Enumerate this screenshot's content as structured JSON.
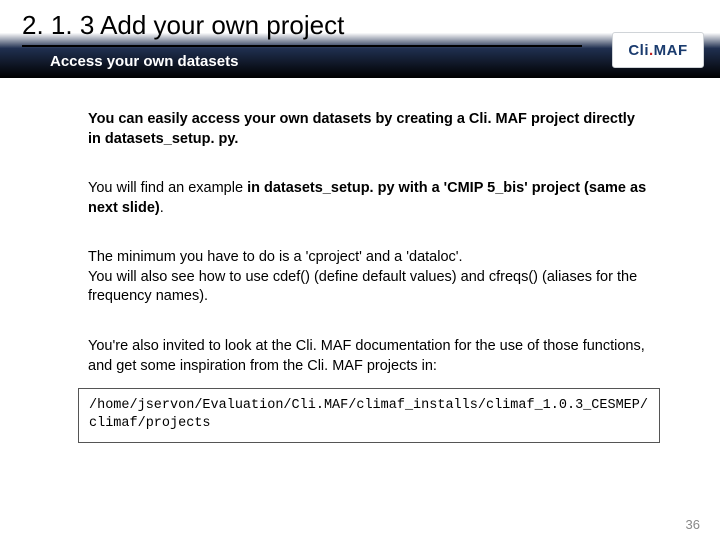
{
  "header": {
    "title": "2. 1. 3 Add your own project",
    "subtitle": "Access your own datasets",
    "logo": {
      "part1": "Cli",
      "part2": ".",
      "part3": "MAF"
    }
  },
  "paragraphs": {
    "p1a": "You can easily access your own datasets by creating a Cli. MAF project directly in datasets_setup. py.",
    "p2a": "You will find an example ",
    "p2b": "in datasets_setup. py with a 'CMIP 5_bis' project (same as next slide)",
    "p2c": ".",
    "p3": "The minimum you have to do is a 'cproject' and a 'dataloc'.\nYou will also see how to use cdef() (define default values) and cfreqs() (aliases for the frequency names).",
    "p4": "You're also invited to look at the Cli. MAF documentation for the use of those functions, and get some inspiration from the Cli. MAF projects in:"
  },
  "codebox": "/home/jservon/Evaluation/Cli.MAF/climaf_installs/climaf_1.0.3_CESMEP/climaf/projects",
  "page_number": "36"
}
